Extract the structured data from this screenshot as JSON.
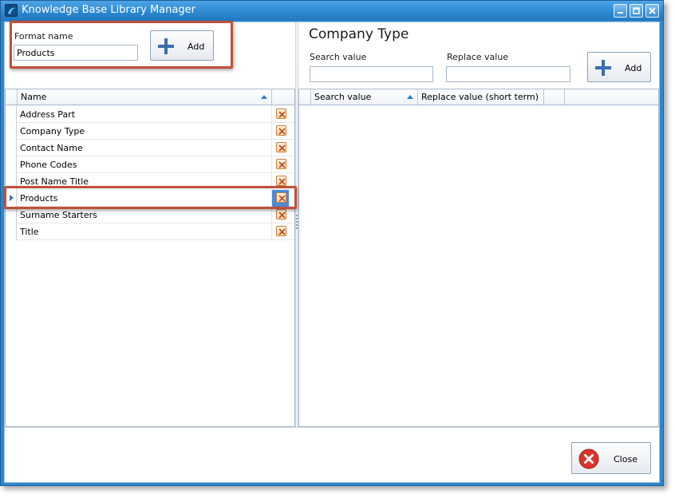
{
  "window": {
    "title": "Knowledge Base Library Manager"
  },
  "format_panel": {
    "label": "Format name",
    "value": "Products",
    "add_label": "Add"
  },
  "names_grid": {
    "header": "Name",
    "rows": [
      "Address Part",
      "Company Type",
      "Contact Name",
      "Phone Codes",
      "Post Name Title",
      "Products",
      "Surname Starters",
      "Title"
    ],
    "selected": "Products"
  },
  "detail_panel": {
    "title": "Company Type",
    "search_label": "Search value",
    "search_value": "",
    "replace_label": "Replace value",
    "replace_value": "",
    "add_label": "Add",
    "columns": [
      "Search value",
      "Replace value (short term)"
    ]
  },
  "footer": {
    "close_label": "Close"
  },
  "colors": {
    "title_bar": "#2a86cf",
    "highlight": "#c0503a",
    "selected_cell": "#4a8bd6",
    "add_icon": "#3a6fb0",
    "close_icon": "#d9342b"
  }
}
